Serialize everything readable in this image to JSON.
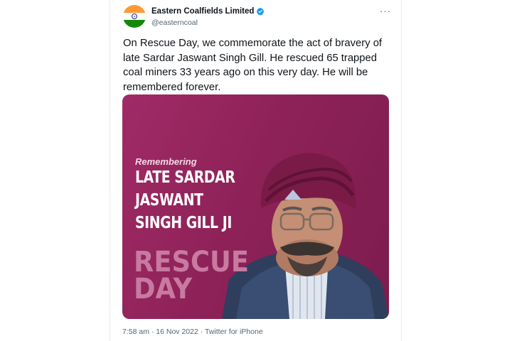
{
  "tweet": {
    "author_name": "Eastern Coalfields Limited",
    "handle": "@easterncoal",
    "more_label": "···",
    "text": "On Rescue Day, we commemorate the act of bravery of late Sardar Jaswant Singh Gill. He rescued 65 trapped coal miners 33 years ago on this very day. He will be remembered forever.",
    "timestamp": "7:58 am · 16 Nov 2022 · Twitter for iPhone"
  },
  "media": {
    "remembering": "Remembering",
    "name_lines": [
      "LATE SARDAR",
      "JASWANT",
      "SINGH GILL JI"
    ],
    "rescue_lines": [
      "RESCUE",
      "DAY"
    ]
  },
  "colors": {
    "verified": "#1d9bf0",
    "media_bg": "#912459",
    "turban": "#7a1b47"
  }
}
